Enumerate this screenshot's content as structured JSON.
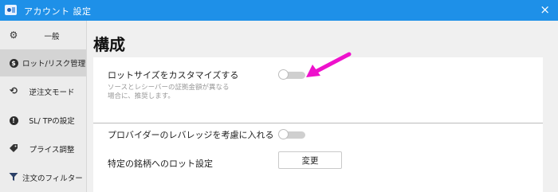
{
  "window": {
    "title": "アカウント 設定",
    "close_glyph": "×",
    "icons": {
      "app": "account-app-icon",
      "close": "close-icon"
    }
  },
  "sidebar": {
    "items": [
      {
        "label": "一般",
        "icon": "gear-icon",
        "glyph": "⚙",
        "active": false
      },
      {
        "label": "ロット/リスク管理",
        "icon": "dollar-circle-icon",
        "glyph": "$",
        "active": true
      },
      {
        "label": "逆注文モード",
        "icon": "reverse-arrows-icon",
        "glyph": "⟲",
        "active": false
      },
      {
        "label": "SL/ TPの設定",
        "icon": "exclamation-circle-icon",
        "glyph": "!",
        "active": false
      },
      {
        "label": "プライス調整",
        "icon": "tag-icon",
        "glyph": "🏷",
        "active": false
      },
      {
        "label": "注文のフィルター",
        "icon": "filter-icon",
        "glyph": "▼",
        "active": false
      }
    ]
  },
  "main": {
    "heading": "構成",
    "settings": [
      {
        "label": "ロットサイズをカスタマイズする",
        "description": "ソースとレシーバーの証拠金額が異なる場合に、推奨します。",
        "enabled": false
      },
      {
        "label": "プロバイダーのレバレッジを考慮に入れる",
        "enabled": false
      }
    ],
    "symbol_lot": {
      "label": "特定の銘柄へのロット設定",
      "button_label": "変更"
    }
  },
  "annotation": {
    "arrow_color": "#ee11cc",
    "icon": "pink-arrow-annotation"
  },
  "colors": {
    "titlebar": "#1e90e8",
    "sidebar_active": "#d4d4d4",
    "toggle_off": "#cfcfcf"
  }
}
